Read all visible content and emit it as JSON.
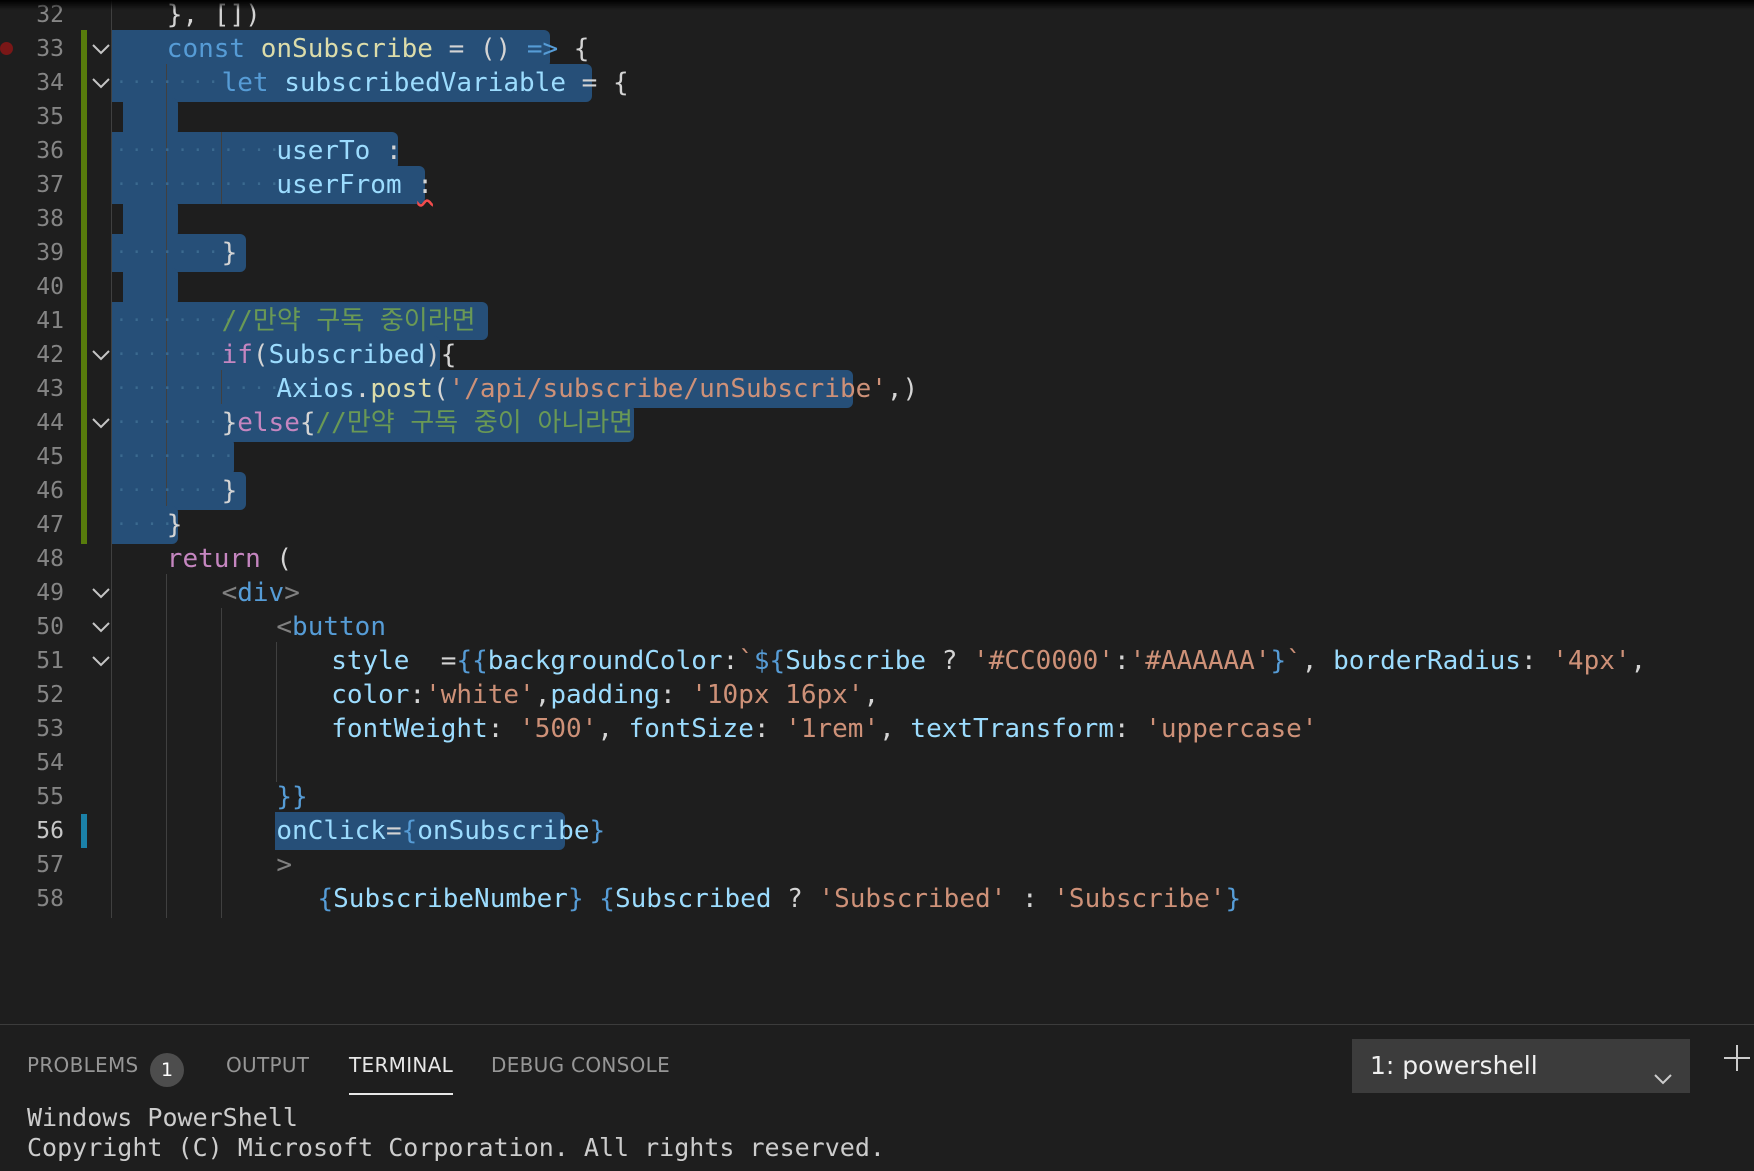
{
  "editor": {
    "lines": [
      {
        "n": "32",
        "html_parts": [
          {
            "t": "}, []) ",
            "c": ""
          }
        ]
      },
      {
        "n": "33",
        "parts": [
          {
            "t": "const",
            "c": "kw"
          },
          {
            "t": " ",
            "c": ""
          },
          {
            "t": "onSubscribe",
            "c": "fn"
          },
          {
            "t": " = () ",
            "c": ""
          },
          {
            "t": "=>",
            "c": "kw"
          },
          {
            "t": " {",
            "c": ""
          }
        ]
      },
      {
        "n": "34",
        "parts": [
          {
            "t": "let",
            "c": "kw"
          },
          {
            "t": " ",
            "c": ""
          },
          {
            "t": "subscribedVariable",
            "c": "var"
          },
          {
            "t": " = {",
            "c": ""
          }
        ]
      },
      {
        "n": "35",
        "parts": []
      },
      {
        "n": "36",
        "parts": [
          {
            "t": "userTo",
            "c": "var"
          },
          {
            "t": " :",
            "c": ""
          }
        ]
      },
      {
        "n": "37",
        "parts": [
          {
            "t": "userFrom",
            "c": "var"
          },
          {
            "t": " ",
            "c": ""
          },
          {
            "t": ":",
            "c": "squig"
          }
        ]
      },
      {
        "n": "38",
        "parts": []
      },
      {
        "n": "39",
        "parts": [
          {
            "t": "}",
            "c": ""
          }
        ]
      },
      {
        "n": "40",
        "parts": []
      },
      {
        "n": "41",
        "parts": [
          {
            "t": "//만약 구독 중이라면",
            "c": "cmt"
          }
        ]
      },
      {
        "n": "42",
        "parts": [
          {
            "t": "if",
            "c": "ctl"
          },
          {
            "t": "(",
            "c": ""
          },
          {
            "t": "Subscribed",
            "c": "var"
          },
          {
            "t": "){",
            "c": ""
          }
        ]
      },
      {
        "n": "43",
        "parts": [
          {
            "t": "Axios",
            "c": "var"
          },
          {
            "t": ".",
            "c": ""
          },
          {
            "t": "post",
            "c": "fn"
          },
          {
            "t": "(",
            "c": ""
          },
          {
            "t": "'/api/subscribe/unSubscribe'",
            "c": "str"
          },
          {
            "t": ",)",
            "c": ""
          }
        ]
      },
      {
        "n": "44",
        "parts": [
          {
            "t": "}",
            "c": ""
          },
          {
            "t": "else",
            "c": "ctl"
          },
          {
            "t": "{",
            "c": ""
          },
          {
            "t": "//만약 구독 중이 아니라면",
            "c": "cmt"
          }
        ]
      },
      {
        "n": "45",
        "parts": []
      },
      {
        "n": "46",
        "parts": [
          {
            "t": "}",
            "c": ""
          }
        ]
      },
      {
        "n": "47",
        "parts": [
          {
            "t": "}",
            "c": ""
          }
        ]
      },
      {
        "n": "48",
        "parts": [
          {
            "t": "return",
            "c": "ctl"
          },
          {
            "t": " (",
            "c": ""
          }
        ]
      },
      {
        "n": "49",
        "parts": [
          {
            "t": "<",
            "c": "pun"
          },
          {
            "t": "div",
            "c": "tag"
          },
          {
            "t": ">",
            "c": "pun"
          }
        ]
      },
      {
        "n": "50",
        "parts": [
          {
            "t": "<",
            "c": "pun"
          },
          {
            "t": "button",
            "c": "tag"
          }
        ]
      },
      {
        "n": "51",
        "parts": [
          {
            "t": "style",
            "c": "var"
          },
          {
            "t": "  =",
            "c": ""
          },
          {
            "t": "{{",
            "c": "kw"
          },
          {
            "t": "backgroundColor",
            "c": "var"
          },
          {
            "t": ":",
            "c": ""
          },
          {
            "t": "`",
            "c": "str"
          },
          {
            "t": "${",
            "c": "kw"
          },
          {
            "t": "Subscribe",
            "c": "var"
          },
          {
            "t": " ? ",
            "c": ""
          },
          {
            "t": "'#CC0000'",
            "c": "str"
          },
          {
            "t": ":",
            "c": ""
          },
          {
            "t": "'#AAAAAA'",
            "c": "str"
          },
          {
            "t": "}",
            "c": "kw"
          },
          {
            "t": "`",
            "c": "str"
          },
          {
            "t": ", ",
            "c": ""
          },
          {
            "t": "borderRadius",
            "c": "var"
          },
          {
            "t": ": ",
            "c": ""
          },
          {
            "t": "'4px'",
            "c": "str"
          },
          {
            "t": ",",
            "c": ""
          }
        ]
      },
      {
        "n": "52",
        "parts": [
          {
            "t": "color",
            "c": "var"
          },
          {
            "t": ":",
            "c": ""
          },
          {
            "t": "'white'",
            "c": "str"
          },
          {
            "t": ",",
            "c": ""
          },
          {
            "t": "padding",
            "c": "var"
          },
          {
            "t": ": ",
            "c": ""
          },
          {
            "t": "'10px 16px'",
            "c": "str"
          },
          {
            "t": ",",
            "c": ""
          }
        ]
      },
      {
        "n": "53",
        "parts": [
          {
            "t": "fontWeight",
            "c": "var"
          },
          {
            "t": ": ",
            "c": ""
          },
          {
            "t": "'500'",
            "c": "str"
          },
          {
            "t": ", ",
            "c": ""
          },
          {
            "t": "fontSize",
            "c": "var"
          },
          {
            "t": ": ",
            "c": ""
          },
          {
            "t": "'1rem'",
            "c": "str"
          },
          {
            "t": ", ",
            "c": ""
          },
          {
            "t": "textTransform",
            "c": "var"
          },
          {
            "t": ": ",
            "c": ""
          },
          {
            "t": "'uppercase'",
            "c": "str"
          }
        ]
      },
      {
        "n": "54",
        "parts": []
      },
      {
        "n": "55",
        "parts": [
          {
            "t": "}}",
            "c": "kw"
          }
        ]
      },
      {
        "n": "56",
        "parts": [
          {
            "t": "onClick",
            "c": "var"
          },
          {
            "t": "=",
            "c": ""
          },
          {
            "t": "{",
            "c": "kw"
          },
          {
            "t": "onSubscribe",
            "c": "var"
          },
          {
            "t": "}",
            "c": "kw"
          }
        ]
      },
      {
        "n": "57",
        "parts": [
          {
            "t": ">",
            "c": "pun"
          }
        ]
      },
      {
        "n": "58",
        "parts": [
          {
            "t": "{",
            "c": "kw"
          },
          {
            "t": "SubscribeNumber",
            "c": "var"
          },
          {
            "t": "}",
            "c": "kw"
          },
          {
            "t": " ",
            "c": ""
          },
          {
            "t": "{",
            "c": "kw"
          },
          {
            "t": "Subscribed",
            "c": "var"
          },
          {
            "t": " ? ",
            "c": ""
          },
          {
            "t": "'Subscribed'",
            "c": "str"
          },
          {
            "t": " : ",
            "c": ""
          },
          {
            "t": "'Subscribe'",
            "c": "str"
          },
          {
            "t": "}",
            "c": "kw"
          }
        ]
      }
    ]
  },
  "panel": {
    "tabs": [
      {
        "label": "PROBLEMS"
      },
      {
        "label": "OUTPUT"
      },
      {
        "label": "TERMINAL"
      },
      {
        "label": "DEBUG CONSOLE"
      }
    ],
    "problems_count": "1",
    "active_tab": "TERMINAL",
    "terminal_selector": "1: powershell",
    "terminal_output": [
      "Windows PowerShell",
      "Copyright (C) Microsoft Corporation. All rights reserved."
    ]
  },
  "colors": {
    "selection": "#264f78",
    "git_added": "#587c0c",
    "git_modified": "#1b81a8",
    "breakpoint": "#7a1717"
  }
}
